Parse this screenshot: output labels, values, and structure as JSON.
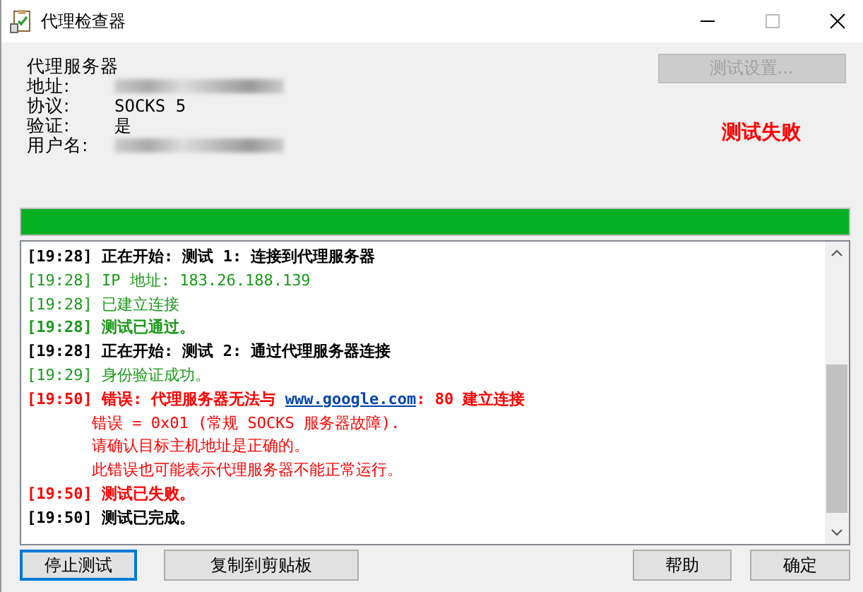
{
  "window": {
    "title": "代理检查器"
  },
  "server": {
    "heading": "代理服务器",
    "fields": [
      {
        "label": "地址:",
        "kind": "redacted"
      },
      {
        "label": "协议:",
        "kind": "text",
        "value": "SOCKS 5"
      },
      {
        "label": "验证:",
        "kind": "text",
        "value": "是"
      },
      {
        "label": "用户名:",
        "kind": "redacted"
      }
    ]
  },
  "settings_button": {
    "label": "测试设置...",
    "disabled": true
  },
  "result": "测试失败",
  "progress": {
    "level": 1
  },
  "log": [
    {
      "kind": "header",
      "text": "[19:28] 正在开始: 测试 1: 连接到代理服务器"
    },
    {
      "kind": "info",
      "text": "[19:28] IP 地址: 183.26.188.139"
    },
    {
      "kind": "info",
      "text": "[19:28] 已建立连接"
    },
    {
      "kind": "pass",
      "text": "[19:28] 测试已通过。"
    },
    {
      "kind": "header",
      "text": "[19:28] 正在开始: 测试 2: 通过代理服务器连接"
    },
    {
      "kind": "info",
      "text": "[19:29] 身份验证成功。"
    },
    {
      "kind": "error",
      "text": "[19:50] 错误: 代理服务器无法与 ",
      "link": "www.google.com",
      "after": ": 80 建立连接"
    },
    {
      "kind": "detail",
      "text": "错误 = 0x01 (常规 SOCKS 服务器故障)."
    },
    {
      "kind": "detail",
      "text": "请确认目标主机地址是正确的。"
    },
    {
      "kind": "detail",
      "text": "此错误也可能表示代理服务器不能正常运行。"
    },
    {
      "kind": "fail",
      "text": "[19:50] 测试已失败。"
    },
    {
      "kind": "header",
      "text": "[19:50] 测试已完成。"
    }
  ],
  "buttons": [
    {
      "label": "停止测试",
      "focused": true
    },
    {
      "label": "复制到剪贴板",
      "focused": false
    },
    {
      "label": "帮助",
      "focused": false
    },
    {
      "label": "确定",
      "focused": false
    }
  ]
}
